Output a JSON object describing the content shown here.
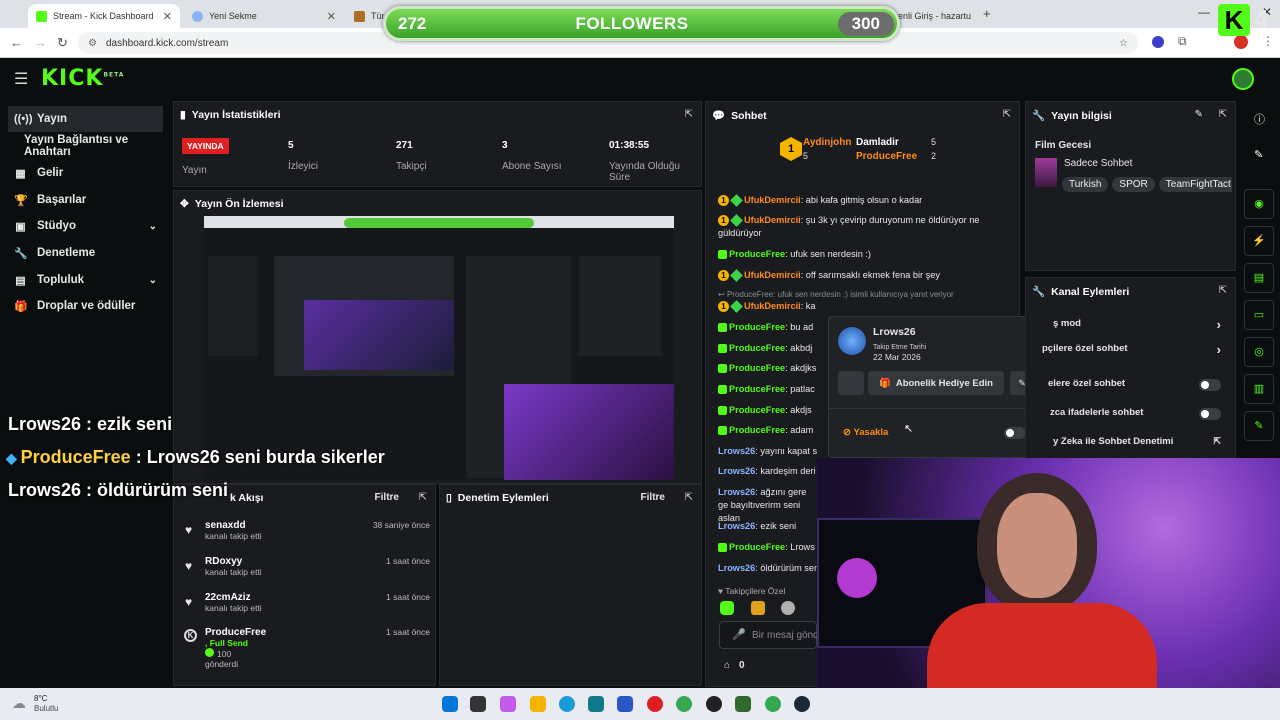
{
  "browser": {
    "tabs": [
      {
        "title": "Stream - Kick Dashboard",
        "active": true
      },
      {
        "title": "Yeni Sekme"
      },
      {
        "title": "Türki"
      },
      {
        "title": "E-posta Güvenli Giriş - hazartu"
      }
    ],
    "url": "dashboard.kick.com/stream"
  },
  "overlay": {
    "followers_current": "272",
    "followers_title": "FOLLOWERS",
    "followers_goal": "300",
    "kick_count": "4",
    "chat_overlay": [
      {
        "user": "Lrows26",
        "text": " : ezik seni"
      },
      {
        "user": "ProduceFree",
        "text": " : Lrows26 seni burda sikerler"
      },
      {
        "user": "Lrows26",
        "text": " : öldürürüm seni"
      }
    ]
  },
  "header": {
    "logo": "KICK",
    "logo_beta": "BETA"
  },
  "sidebar": {
    "items": [
      {
        "label": "Yayın",
        "icon": "broadcast-icon"
      },
      {
        "label": "Yayın Bağlantısı ve Anahtarı",
        "icon": ""
      },
      {
        "label": "Gelir",
        "icon": "revenue-icon"
      },
      {
        "label": "Başarılar",
        "icon": "trophy-icon"
      },
      {
        "label": "Stüdyo",
        "icon": "studio-icon"
      },
      {
        "label": "Denetleme",
        "icon": "wrench-icon"
      },
      {
        "label": "Topluluk",
        "icon": "community-icon"
      },
      {
        "label": "Droplar ve ödüller",
        "icon": "gift-icon"
      }
    ]
  },
  "stats": {
    "title": "Yayın İstatistikleri",
    "live_badge": "YAYINDA",
    "live_label": "Yayın",
    "viewers": "5",
    "viewers_label": "İzleyici",
    "followers": "271",
    "followers_label": "Takipçi",
    "subs": "3",
    "subs_label": "Abone Sayısı",
    "duration": "01:38:55",
    "duration_label": "Yayında Olduğu Süre"
  },
  "preview": {
    "title": "Yayın Ön İzlemesi"
  },
  "activity": {
    "title": "k Akışı",
    "filter": "Filtre",
    "items": [
      {
        "name": "senaxdd",
        "sub": "kanalı takip etti",
        "time": "38 saniye önce"
      },
      {
        "name": "RDoxyy",
        "sub": "kanalı takip etti",
        "time": "1 saat önce"
      },
      {
        "name": "22cmAziz",
        "sub": "kanalı takip etti",
        "time": "1 saat önce"
      },
      {
        "name": "ProduceFree",
        "sub": ", Full Send",
        "extra": "100",
        "extra2": "gönderdi",
        "time": "1 saat önce"
      }
    ]
  },
  "moderation": {
    "title": "Denetim Eylemleri",
    "filter": "Filtre"
  },
  "chat": {
    "title": "Sohbet",
    "top_user": "Aydinjohn",
    "top_user_score": "5",
    "second_title": "Damladir",
    "second_score": "5",
    "third_user": "ProduceFree",
    "third_score": "2",
    "lines": [
      {
        "user": "UfukDemircii",
        "color": "orange",
        "text": "abi kafa gitmiş olsun o kadar"
      },
      {
        "user": "UfukDemircii",
        "color": "orange",
        "text": "şu 3k yı çevirip duruyorum ne öldürüyor ne güldürüyor"
      },
      {
        "user": "ProduceFree",
        "color": "green",
        "text": "ufuk sen nerdesin :)"
      },
      {
        "user": "UfukDemircii",
        "color": "orange",
        "text": "off sarımsaklı ekmek fena bir şey"
      },
      {
        "user": "ProduceFree",
        "color": "reply",
        "text": "ufuk sen nerdesin :) isimli kullanıcıya yanıt veriyor"
      },
      {
        "user": "UfukDemircii",
        "color": "orange",
        "text": "ka"
      },
      {
        "user": "ProduceFree",
        "color": "green",
        "text": "bu ad"
      },
      {
        "user": "ProduceFree",
        "color": "green",
        "text": "akbdj"
      },
      {
        "user": "ProduceFree",
        "color": "green",
        "text": "akdjks"
      },
      {
        "user": "ProduceFree",
        "color": "green",
        "text": "patlac"
      },
      {
        "user": "ProduceFree",
        "color": "green",
        "text": "akdjs"
      },
      {
        "user": "ProduceFree",
        "color": "green",
        "text": "adam"
      },
      {
        "user": "Lrows26",
        "color": "blue",
        "text": "yayını kapat s"
      },
      {
        "user": "Lrows26",
        "color": "blue",
        "text": "kardeşim deri"
      },
      {
        "user": "Lrows26",
        "color": "blue",
        "text": "ağzını gere ge bayıltıverirm seni aslan"
      },
      {
        "user": "Lrows26",
        "color": "blue",
        "text": "ezik seni"
      },
      {
        "user": "ProduceFree",
        "color": "green",
        "text": "Lrows"
      },
      {
        "user": "Lrows26",
        "color": "blue",
        "text": "öldürürüm seni"
      }
    ],
    "followers_only": "Takipçilere Özel",
    "input_placeholder": "Bir mesaj gönd",
    "bottom_count": "0"
  },
  "user_card": {
    "name": "Lrows26",
    "follow_label": "Takip Etme Tarihi",
    "follow_date": "22 Mar 2026",
    "gift_button": "Abonelik Hediye Edin",
    "ban_label": "Yasakla"
  },
  "stream_info": {
    "title": "Yayın bilgisi",
    "stream_title": "Film Gecesi",
    "category": "Sadece Sohbet",
    "tags": [
      "Turkish",
      "SPOR",
      "TeamFightTact"
    ]
  },
  "channel_actions": {
    "title": "Kanal Eylemleri",
    "items": [
      {
        "label": "ş mod"
      },
      {
        "label": "pçilere özel sohbet"
      },
      {
        "label": "elere özel sohbet"
      },
      {
        "label": "zca ifadelerle sohbet"
      },
      {
        "label": "y Zeka ile Sohbet Denetimi"
      }
    ]
  },
  "taskbar": {
    "temp": "8°C",
    "weather": "Bulutlu"
  },
  "colors": {
    "kick_green": "#53fc18",
    "panel_bg": "#191b1f",
    "page_bg": "#0b0e0f"
  }
}
